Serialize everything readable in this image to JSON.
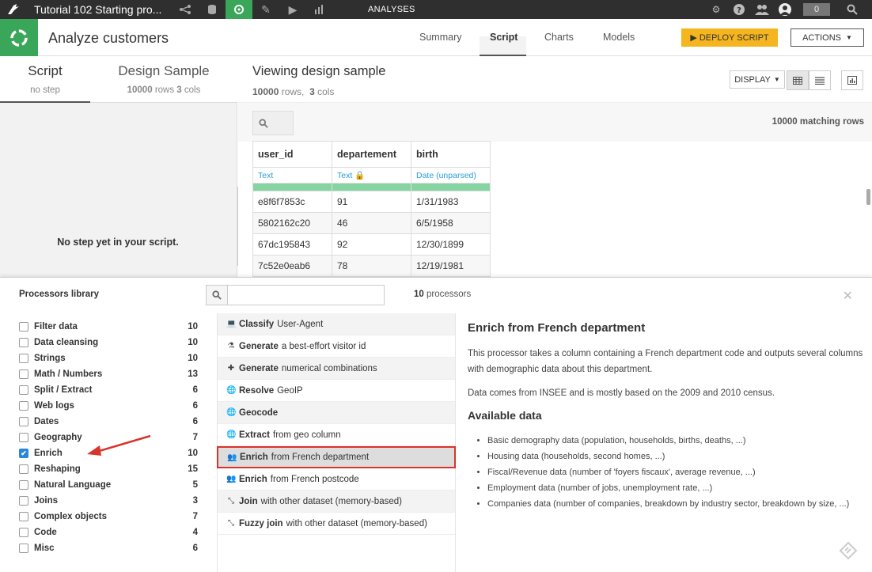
{
  "topbar": {
    "project_name": "Tutorial 102 Starting pro...",
    "section": "ANALYSES",
    "counter": "0"
  },
  "header": {
    "title": "Analyze customers",
    "tabs": [
      "Summary",
      "Script",
      "Charts",
      "Models"
    ],
    "deploy_label": "DEPLOY SCRIPT",
    "actions_label": "ACTIONS"
  },
  "left": {
    "tab_script": "Script",
    "tab_script_sub": "no step",
    "tab_design": "Design Sample",
    "tab_design_rows": "10000",
    "tab_design_rows_lbl": "rows",
    "tab_design_cols": "3",
    "tab_design_cols_lbl": "cols",
    "empty_text": "No step yet in your script."
  },
  "viewer": {
    "title": "Viewing design sample",
    "rows": "10000",
    "rows_lbl": "rows,",
    "cols": "3",
    "cols_lbl": "cols",
    "display_label": "DISPLAY",
    "matching": "10000 matching rows",
    "columns": [
      {
        "name": "user_id",
        "type": "Text",
        "locked": false
      },
      {
        "name": "departement",
        "type": "Text",
        "locked": true
      },
      {
        "name": "birth",
        "type": "Date (unparsed)",
        "locked": false
      }
    ],
    "rows_data": [
      [
        "e8f6f7853c",
        "91",
        "1/31/1983"
      ],
      [
        "5802162c20",
        "46",
        "6/5/1958"
      ],
      [
        "67dc195843",
        "92",
        "12/30/1899"
      ],
      [
        "7c52e0eab6",
        "78",
        "12/19/1981"
      ]
    ]
  },
  "library": {
    "title": "Processors library",
    "count": "10",
    "count_lbl": "processors",
    "categories": [
      {
        "label": "Filter data",
        "count": "10",
        "checked": false
      },
      {
        "label": "Data cleansing",
        "count": "10",
        "checked": false
      },
      {
        "label": "Strings",
        "count": "10",
        "checked": false
      },
      {
        "label": "Math / Numbers",
        "count": "13",
        "checked": false
      },
      {
        "label": "Split / Extract",
        "count": "6",
        "checked": false
      },
      {
        "label": "Web logs",
        "count": "6",
        "checked": false
      },
      {
        "label": "Dates",
        "count": "6",
        "checked": false
      },
      {
        "label": "Geography",
        "count": "7",
        "checked": false
      },
      {
        "label": "Enrich",
        "count": "10",
        "checked": true
      },
      {
        "label": "Reshaping",
        "count": "15",
        "checked": false
      },
      {
        "label": "Natural Language",
        "count": "5",
        "checked": false
      },
      {
        "label": "Joins",
        "count": "3",
        "checked": false
      },
      {
        "label": "Complex objects",
        "count": "7",
        "checked": false
      },
      {
        "label": "Code",
        "count": "4",
        "checked": false
      },
      {
        "label": "Misc",
        "count": "6",
        "checked": false
      }
    ],
    "processors": [
      {
        "icon": "laptop-icon",
        "glyph": "💻",
        "verb": "Classify",
        "rest": "User-Agent",
        "selected": false
      },
      {
        "icon": "flask-icon",
        "glyph": "⚗",
        "verb": "Generate",
        "rest": "a best-effort visitor id",
        "selected": false
      },
      {
        "icon": "plus-icon",
        "glyph": "✚",
        "verb": "Generate",
        "rest": "numerical combinations",
        "selected": false
      },
      {
        "icon": "globe-icon",
        "glyph": "🌐",
        "verb": "Resolve",
        "rest": "GeoIP",
        "selected": false
      },
      {
        "icon": "globe-icon",
        "glyph": "🌐",
        "verb": "Geocode",
        "rest": "",
        "selected": false
      },
      {
        "icon": "globe-icon",
        "glyph": "🌐",
        "verb": "Extract",
        "rest": "from geo column",
        "selected": false
      },
      {
        "icon": "users-icon",
        "glyph": "👥",
        "verb": "Enrich",
        "rest": "from French department",
        "selected": true
      },
      {
        "icon": "users-icon",
        "glyph": "👥",
        "verb": "Enrich",
        "rest": "from French postcode",
        "selected": false
      },
      {
        "icon": "join-icon",
        "glyph": "⤡",
        "verb": "Join",
        "rest": "with other dataset (memory-based)",
        "selected": false
      },
      {
        "icon": "join-icon",
        "glyph": "⤡",
        "verb": "Fuzzy join",
        "rest": "with other dataset (memory-based)",
        "selected": false
      }
    ],
    "description": {
      "title": "Enrich from French department",
      "p1": "This processor takes a column containing a French department code and outputs several columns with demographic data about this department.",
      "p2": "Data comes from INSEE and is mostly based on the 2009 and 2010 census.",
      "subtitle": "Available data",
      "items": [
        "Basic demography data (population, households, births, deaths, ...)",
        "Housing data (households, second homes, ...)",
        "Fiscal/Revenue data (number of 'foyers fiscaux', average revenue, ...)",
        "Employment data (number of jobs, unemployment rate, ...)",
        "Companies data (number of companies, breakdown by industry sector, breakdown by size, ...)"
      ]
    }
  },
  "colors": {
    "accent_green": "#3aa65a",
    "deploy_yellow": "#f4b51e",
    "type_blue": "#2a9fd6",
    "highlight_red": "#d9342b"
  }
}
